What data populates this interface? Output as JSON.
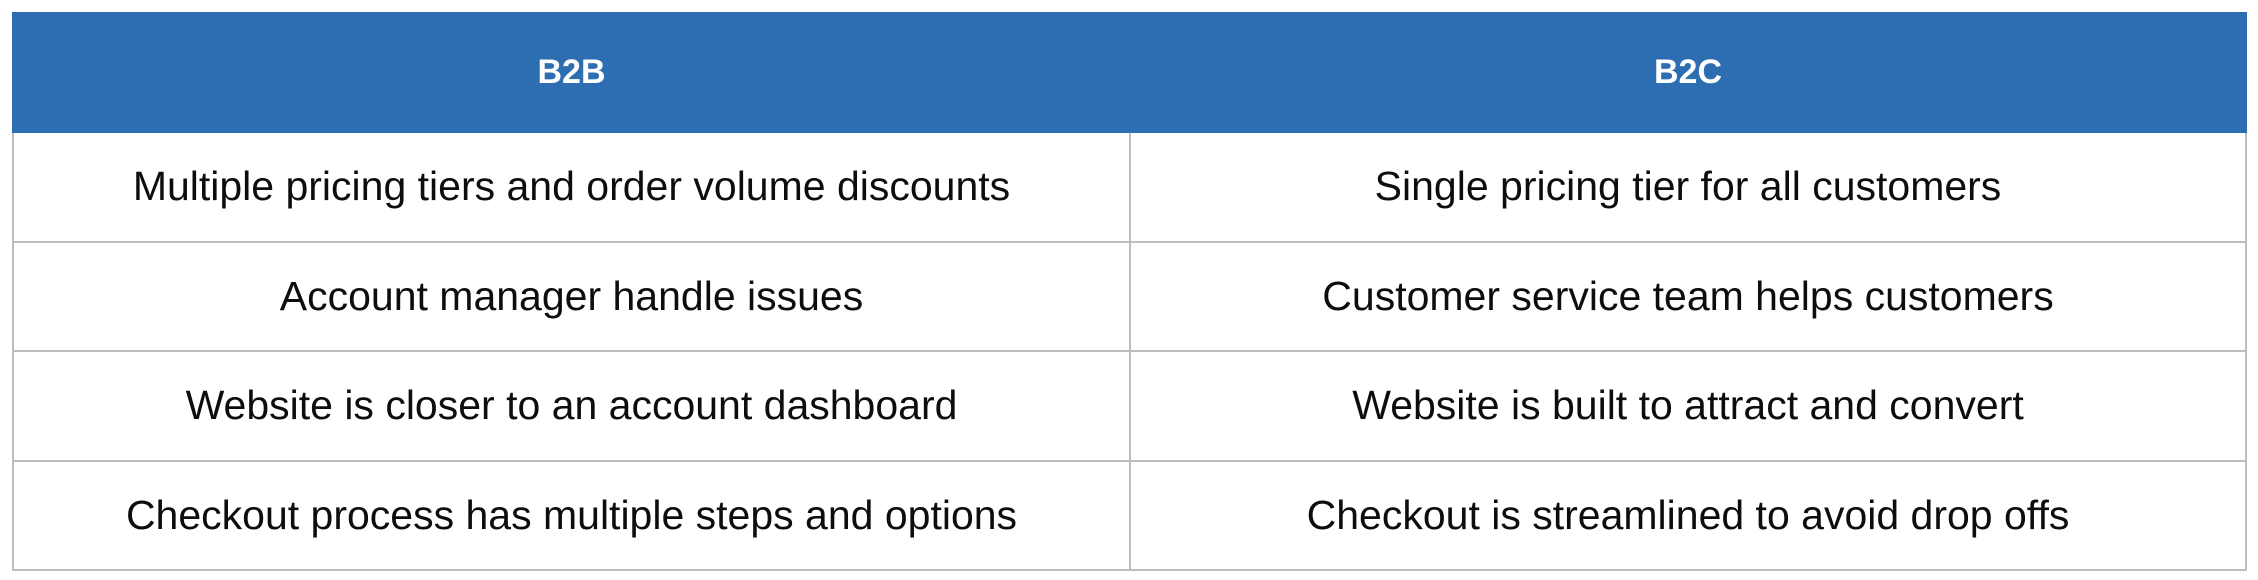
{
  "table": {
    "headers": [
      "B2B",
      "B2C"
    ],
    "rows": [
      [
        "Multiple pricing tiers and order volume discounts",
        "Single pricing tier for all customers"
      ],
      [
        "Account manager handle issues",
        "Customer service team helps customers"
      ],
      [
        "Website is closer to an account dashboard",
        "Website is built to attract and convert"
      ],
      [
        "Checkout process has multiple steps and options",
        "Checkout is streamlined to avoid drop offs"
      ]
    ]
  },
  "colors": {
    "header_background": "#2d6db2",
    "header_text": "#ffffff",
    "cell_border": "#bdbdbd",
    "cell_text": "#0d0d0d"
  }
}
